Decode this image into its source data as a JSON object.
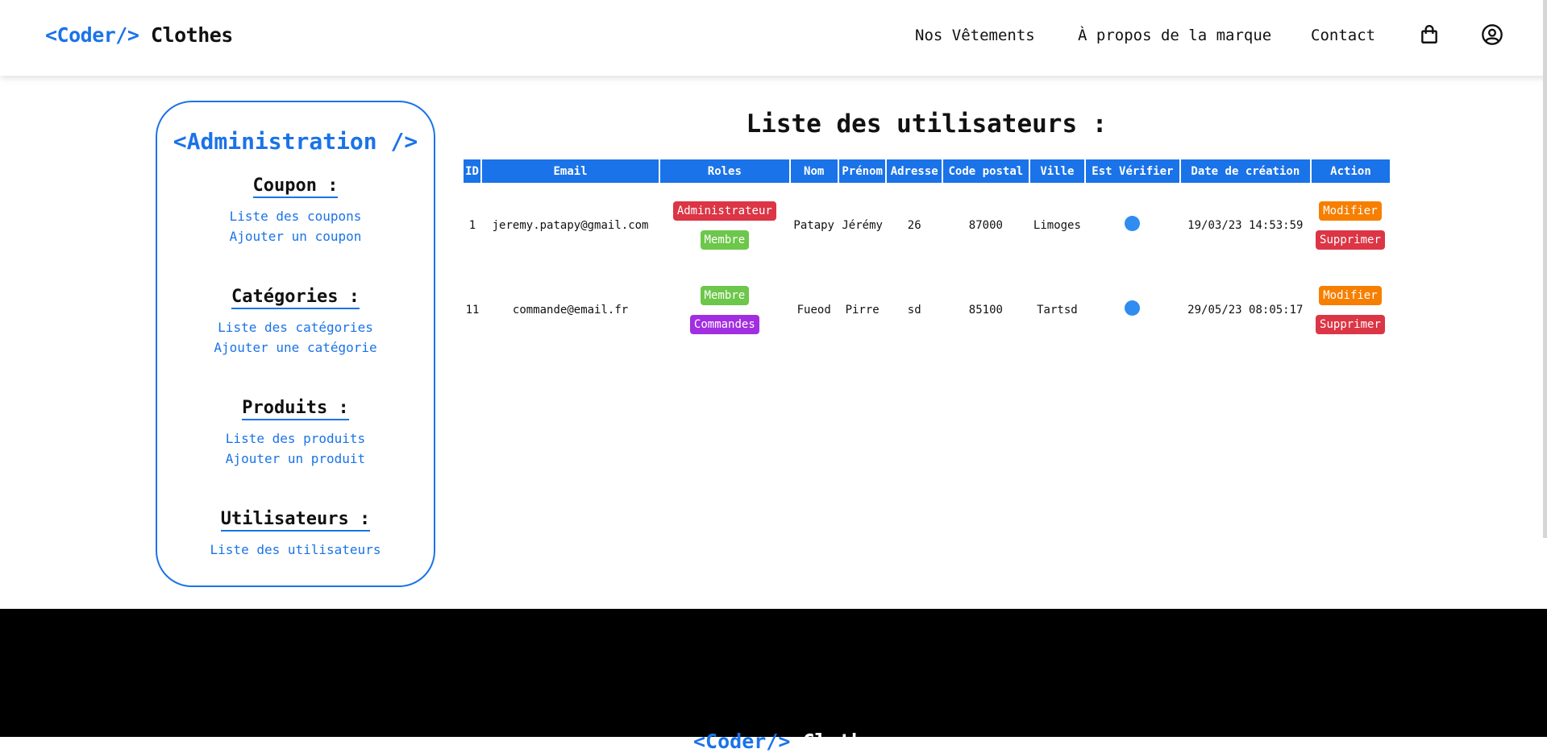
{
  "header": {
    "logo_code": "<Coder/>",
    "logo_brand": "Clothes",
    "nav": [
      "Nos Vêtements",
      "À propos de la marque",
      "Contact"
    ],
    "icons": [
      "shopping-bag-icon",
      "user-account-icon"
    ]
  },
  "sidebar": {
    "title": "<Administration />",
    "sections": [
      {
        "heading": "Coupon :",
        "links": [
          "Liste des coupons",
          "Ajouter un coupon"
        ]
      },
      {
        "heading": "Catégories :",
        "links": [
          "Liste des catégories",
          "Ajouter une catégorie"
        ]
      },
      {
        "heading": "Produits :",
        "links": [
          "Liste des produits",
          "Ajouter un produit"
        ]
      },
      {
        "heading": "Utilisateurs :",
        "links": [
          "Liste des utilisateurs"
        ]
      }
    ]
  },
  "main": {
    "title": "Liste des utilisateurs :",
    "columns": [
      "ID",
      "Email",
      "Roles",
      "Nom",
      "Prénom",
      "Adresse",
      "Code postal",
      "Ville",
      "Est Vérifier",
      "Date de création",
      "Action"
    ],
    "rows": [
      {
        "id": "1",
        "email": "jeremy.patapy@gmail.com",
        "roles": [
          {
            "label": "Administrateur",
            "color": "#dc3545"
          },
          {
            "label": "Membre",
            "color": "#6cc74a"
          }
        ],
        "nom": "Patapy",
        "prenom": "Jérémy",
        "adresse": "26",
        "code_postal": "87000",
        "ville": "Limoges",
        "verified": true,
        "date": "19/03/23 14:53:59",
        "actions": [
          "Modifier",
          "Supprimer"
        ]
      },
      {
        "id": "11",
        "email": "commande@email.fr",
        "roles": [
          {
            "label": "Membre",
            "color": "#6cc74a"
          },
          {
            "label": "Commandes",
            "color": "#a12ee0"
          }
        ],
        "nom": "Fueod",
        "prenom": "Pirre",
        "adresse": "sd",
        "code_postal": "85100",
        "ville": "Tartsd",
        "verified": true,
        "date": "29/05/23 08:05:17",
        "actions": [
          "Modifier",
          "Supprimer"
        ]
      }
    ]
  },
  "footer": {
    "logo_code": "<Coder/>",
    "logo_brand": "Clothes"
  },
  "colors": {
    "accent": "#1a73e8",
    "danger": "#dc3545",
    "success": "#6cc74a",
    "purple": "#a12ee0",
    "warning": "#f77f00",
    "verified_dot": "#2f8cf0"
  }
}
